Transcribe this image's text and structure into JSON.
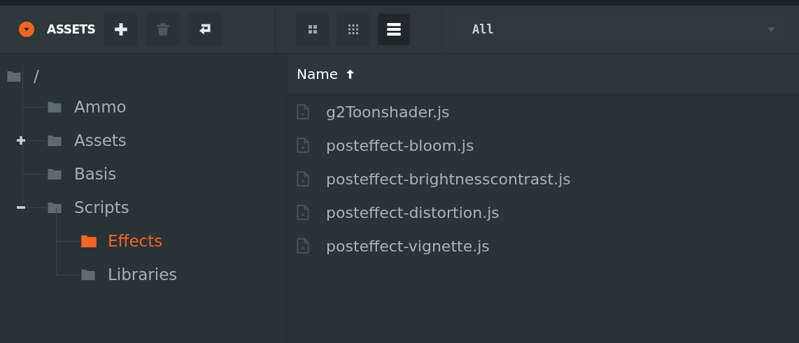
{
  "panel": {
    "title": "ASSETS"
  },
  "toolbar": [
    {
      "kind": "add",
      "disabled": false
    },
    {
      "kind": "delete",
      "disabled": true
    },
    {
      "kind": "back",
      "disabled": false
    }
  ],
  "view_modes": [
    {
      "kind": "large",
      "selected": false
    },
    {
      "kind": "small",
      "selected": false
    },
    {
      "kind": "list",
      "selected": true
    }
  ],
  "filter": {
    "value": "All"
  },
  "tree": {
    "label": "/",
    "selected": false,
    "children": [
      {
        "label": "Ammo",
        "selected": false
      },
      {
        "label": "Assets",
        "selected": false,
        "expanded": false
      },
      {
        "label": "Basis",
        "selected": false
      },
      {
        "label": "Scripts",
        "selected": false,
        "expanded": true,
        "children": [
          {
            "label": "Effects",
            "selected": true
          },
          {
            "label": "Libraries",
            "selected": false
          }
        ]
      }
    ]
  },
  "table": {
    "sort_column": "Name",
    "sort_ascending": true,
    "rows": [
      "g2Toonshader.js",
      "posteffect-bloom.js",
      "posteffect-brightnesscontrast.js",
      "posteffect-distortion.js",
      "posteffect-vignette.js"
    ]
  }
}
